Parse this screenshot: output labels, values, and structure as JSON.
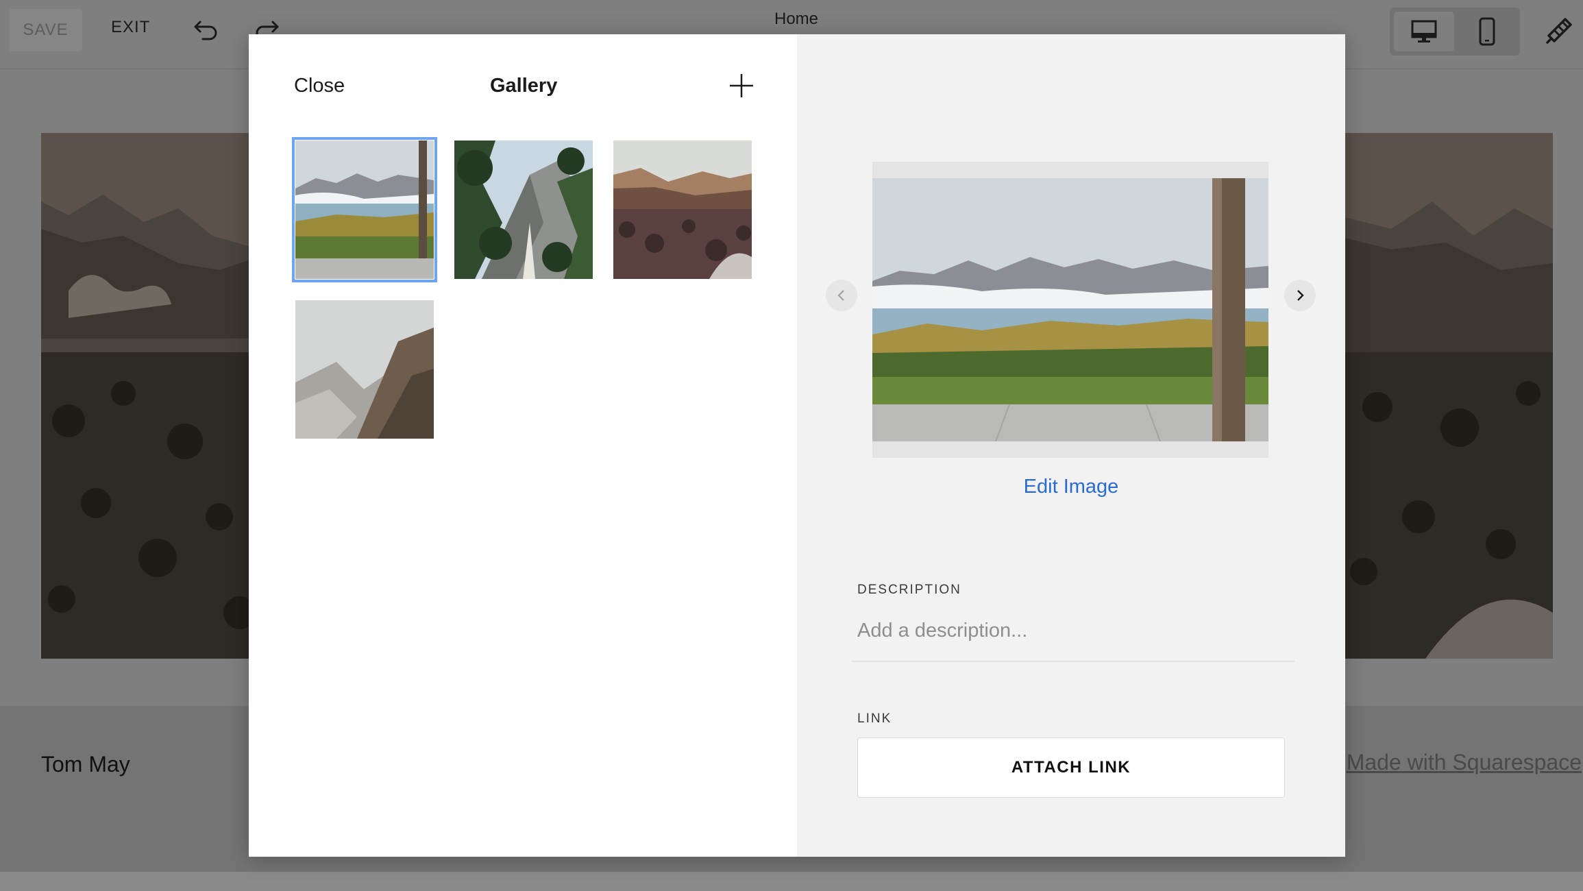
{
  "toolbar": {
    "save_label": "SAVE",
    "exit_label": "EXIT",
    "page_title": "Home",
    "icons": [
      "undo-icon",
      "redo-icon",
      "desktop-icon",
      "mobile-icon",
      "style-icon"
    ]
  },
  "site": {
    "title": "Tom May",
    "footer_link": "Made with Squarespace"
  },
  "gallery": {
    "close_label": "Close",
    "title": "Gallery",
    "add_icon": "plus-icon",
    "thumbnails": [
      {
        "subject": "lake and mountains seen from a terrace",
        "selected": true
      },
      {
        "subject": "trees and rocky peak",
        "selected": false
      },
      {
        "subject": "desert hillside at dusk",
        "selected": false
      },
      {
        "subject": "rocky mountain ridge",
        "selected": false
      }
    ]
  },
  "detail": {
    "edit_image_label": "Edit Image",
    "description_label": "DESCRIPTION",
    "description_placeholder": "Add a description...",
    "description_value": "",
    "link_label": "LINK",
    "attach_link_label": "ATTACH LINK",
    "prev_icon": "chevron-left-icon",
    "next_icon": "chevron-right-icon"
  },
  "colors": {
    "accent": "#2a6bd3",
    "selection": "#6ea5ef",
    "overlay": "#7f7f7f"
  }
}
